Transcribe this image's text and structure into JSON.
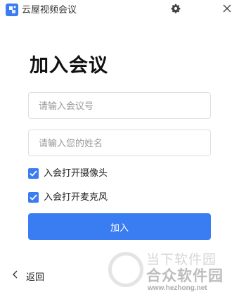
{
  "window": {
    "title": "云屋视频会议",
    "accent_color": "#3a7cf2"
  },
  "icons": {
    "app_logo": "app-logo-icon",
    "settings": "gear-icon",
    "close": "close-icon",
    "back": "chevron-left-icon",
    "checked": "checkmark-icon"
  },
  "page": {
    "heading": "加入会议"
  },
  "form": {
    "meeting_number": {
      "value": "",
      "placeholder": "请输入会议号"
    },
    "name": {
      "value": "",
      "placeholder": "请输入您的姓名"
    },
    "open_camera": {
      "label": "入会打开摄像头",
      "checked": true
    },
    "open_mic": {
      "label": "入会打开麦克风",
      "checked": true
    },
    "join_label": "加入"
  },
  "footer": {
    "back_label": "返回"
  },
  "watermark": {
    "line1": "当下软件园",
    "line2": "合众软件园",
    "url": "www.hezhong.net"
  }
}
